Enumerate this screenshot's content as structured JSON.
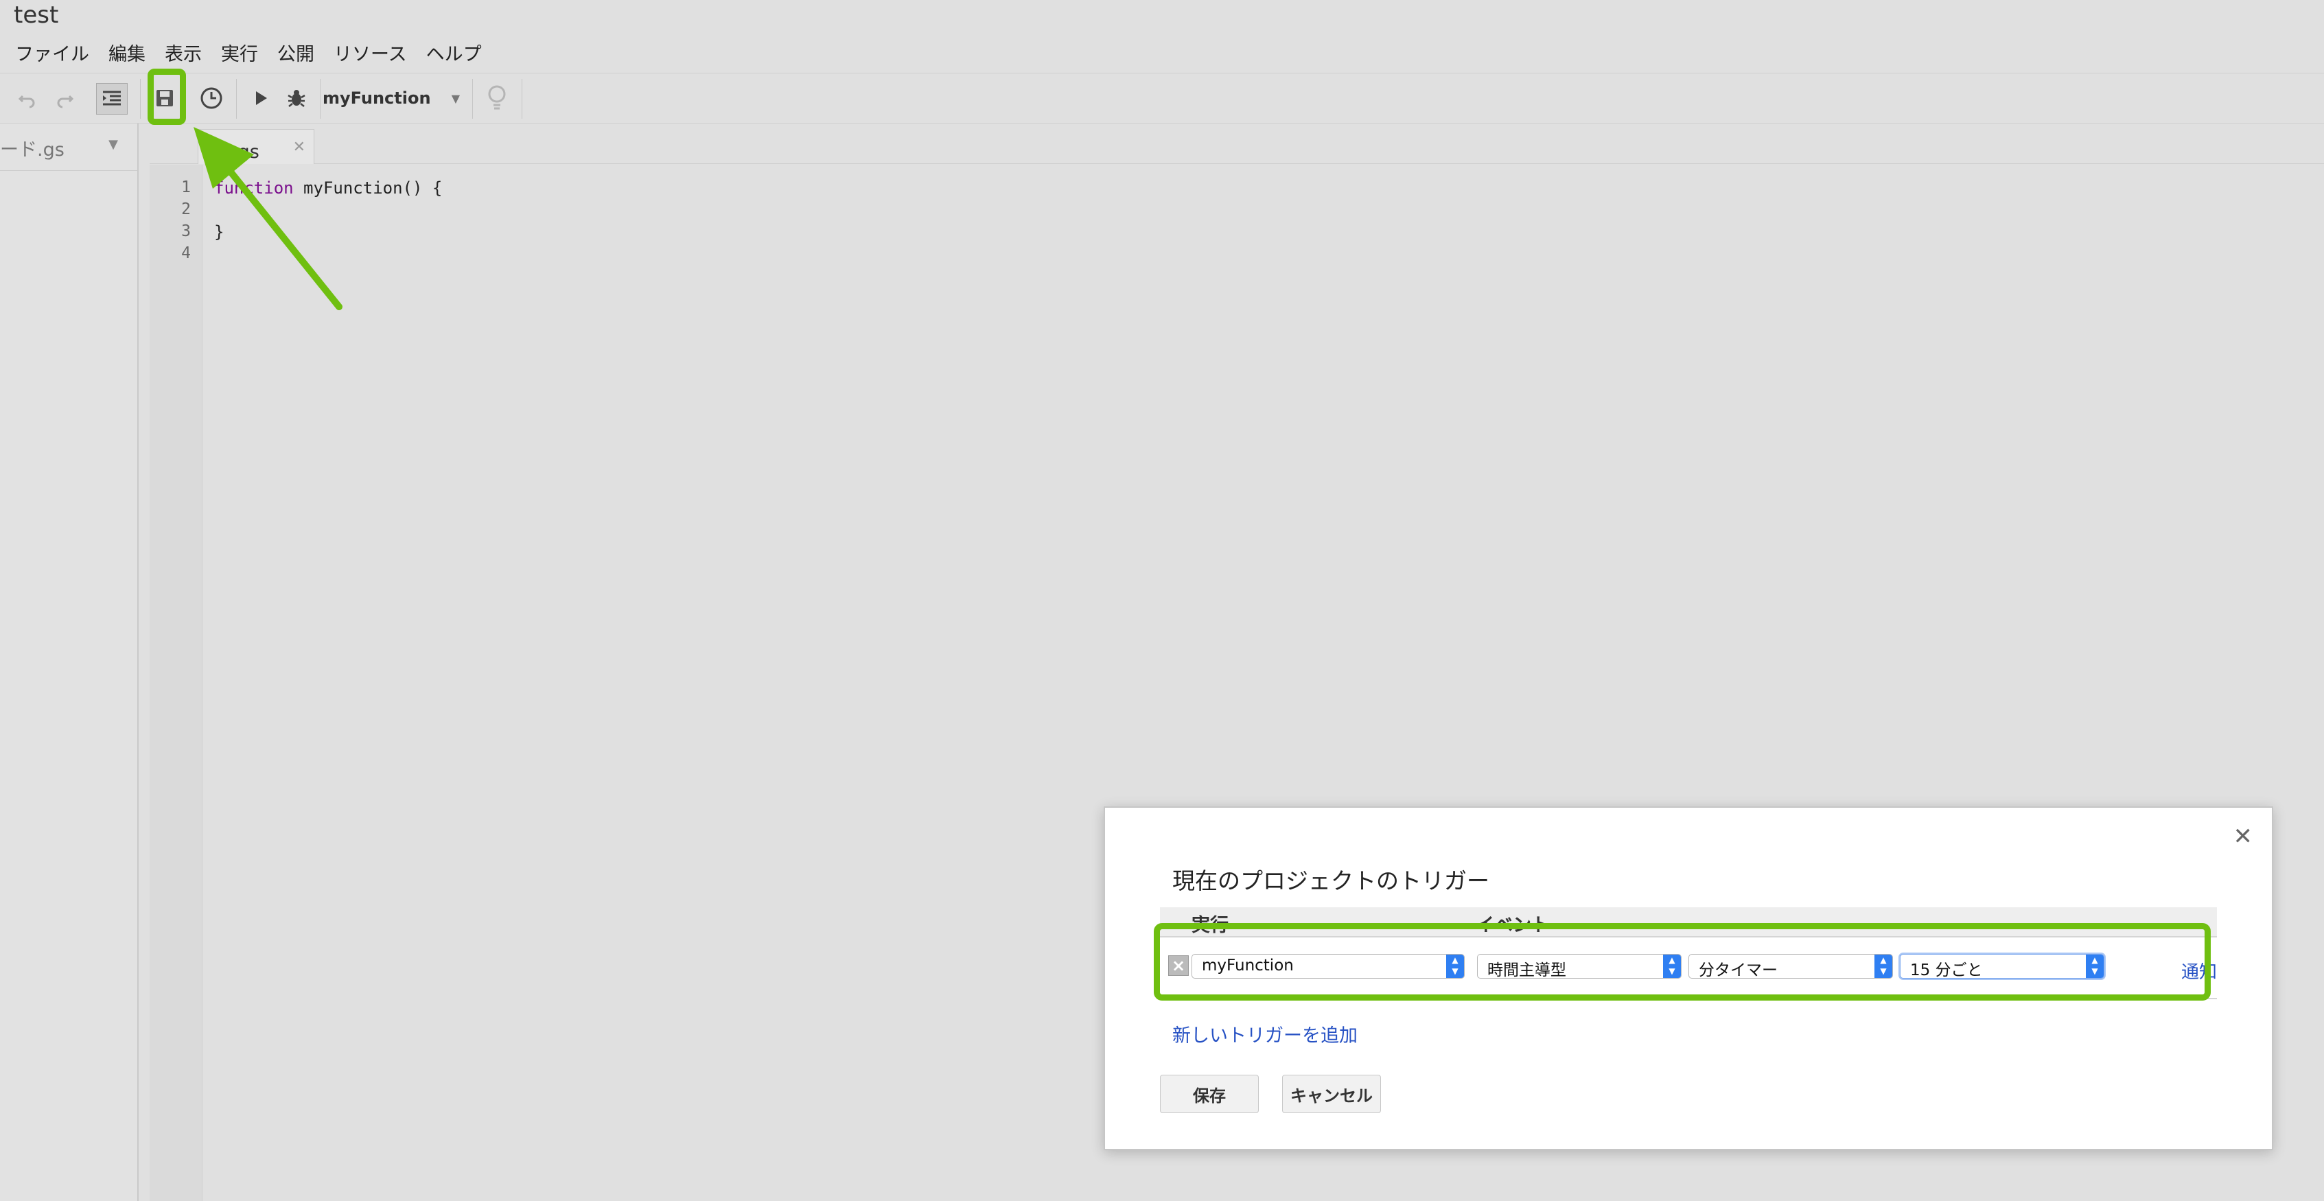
{
  "document": {
    "title": "test"
  },
  "menu": [
    "ファイル",
    "編集",
    "表示",
    "実行",
    "公開",
    "リソース",
    "ヘルプ"
  ],
  "toolbar": {
    "function_select": "myFunction"
  },
  "file_panel": {
    "file_name": "ード.gs"
  },
  "editor": {
    "tab_label": "ド.gs",
    "line_numbers": [
      "1",
      "2",
      "3",
      "4"
    ],
    "code": {
      "keyword": "function",
      "line1_rest": " myFunction() {",
      "line3": "}"
    }
  },
  "dialog": {
    "title": "現在のプロジェクトのトリガー",
    "headers": [
      "実行",
      "イベント"
    ],
    "trigger": {
      "function": "myFunction",
      "event_source": "時間主導型",
      "timer_type": "分タイマー",
      "interval": "15 分ごと",
      "notify_label": "通知"
    },
    "add_trigger_link": "新しいトリガーを追加",
    "save_button": "保存",
    "cancel_button": "キャンセル"
  },
  "colors": {
    "highlight": "#6fbf10",
    "link": "#2752c4",
    "select_accent": "#2f7ff2"
  }
}
